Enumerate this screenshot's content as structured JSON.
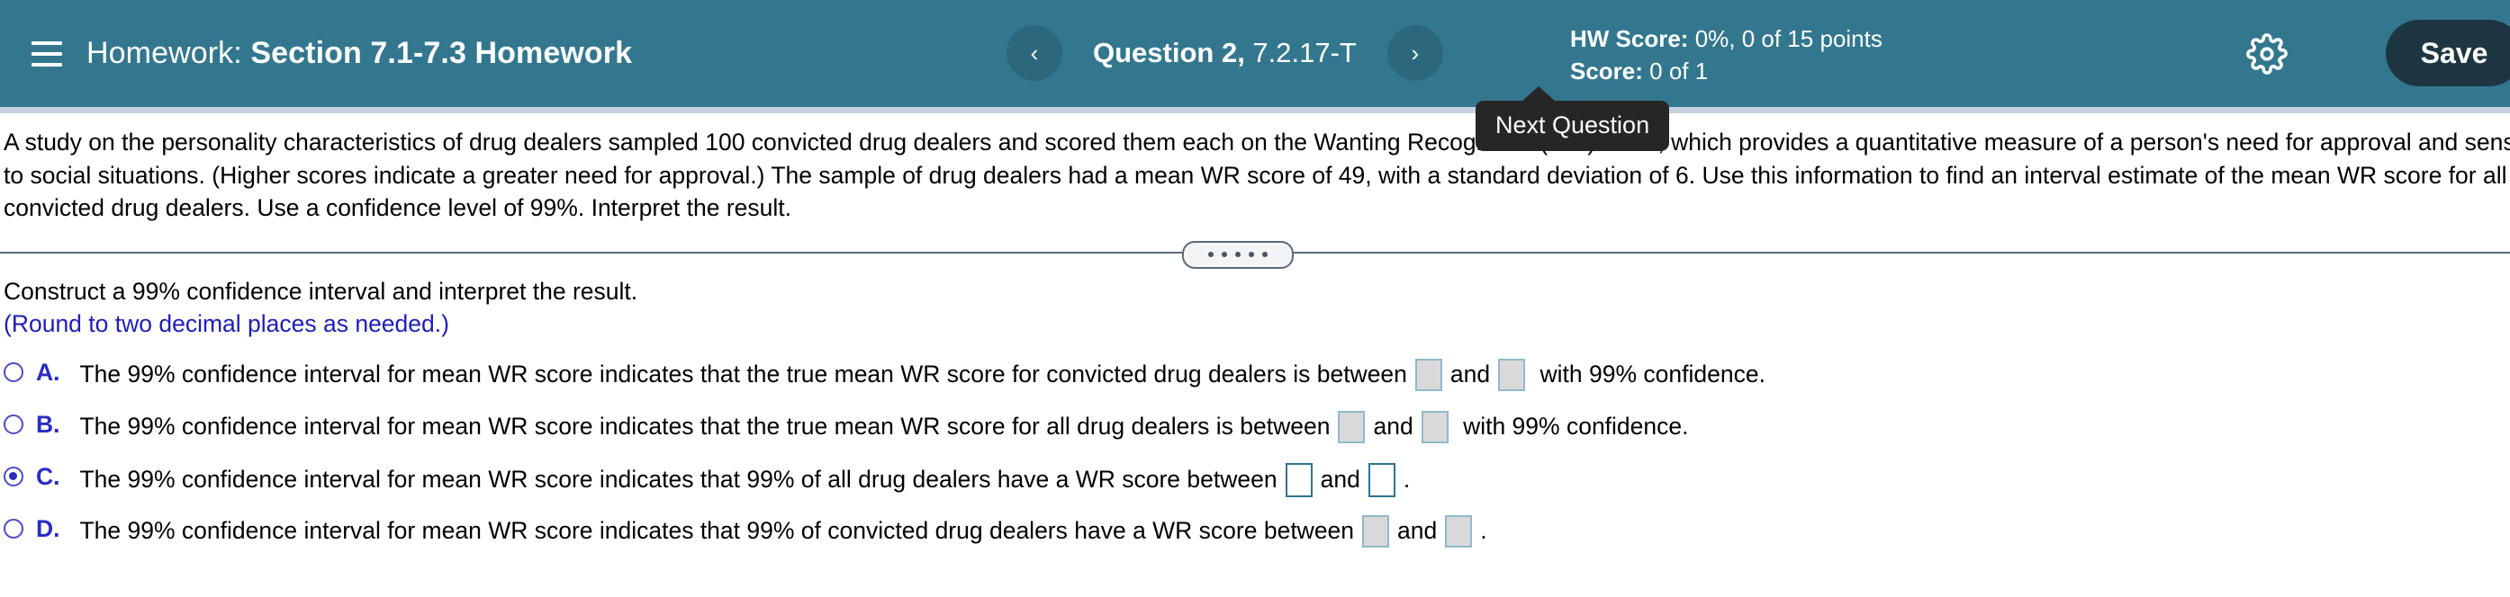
{
  "header": {
    "menu_icon": "hamburger-icon",
    "title_prefix": "Homework: ",
    "title_name": "Section 7.1-7.3 Homework",
    "prev_icon": "‹",
    "next_icon": "›",
    "question_label_strong": "Question 2,",
    "question_label_code": " 7.2.17-T",
    "hw_score_label": "HW Score:",
    "hw_score_value": " 0%, 0 of 15 points",
    "score_label": "Score:",
    "score_value": " 0 of 1",
    "gear_icon": "gear-icon",
    "save_label": "Save",
    "bar_color": "#33778f",
    "save_color": "#1e3542"
  },
  "tooltip": {
    "text": "Next Question"
  },
  "question": {
    "line1": "A study on the personality characteristics of drug dealers sampled 100 convicted drug dealers and scored them each on the Wanting Recognition (WR) scale, which provides a quantitative measure of a person's need for approval and sensitivity",
    "line2": "to social situations. (Higher scores indicate a greater need for approval.) The sample of drug dealers had a mean WR score of 49, with a standard deviation of 6. Use this information to find an interval estimate of the mean WR score for all",
    "line3": "convicted drug dealers. Use a confidence level of 99%. Interpret the result."
  },
  "divider": {
    "dots": 5
  },
  "prompt": {
    "line1": "Construct a 99% confidence interval and interpret the result.",
    "line2": "(Round to two decimal places as needed.)",
    "hint_color": "#1d1dbd"
  },
  "choices": [
    {
      "letter": "A.",
      "selected": false,
      "seg1": "The 99% confidence interval for mean WR score indicates that the true mean WR score for convicted drug dealers is between",
      "seg2": "and",
      "seg3": "with 99% confidence.",
      "box_style": "filled",
      "box1_value": "",
      "box2_value": ""
    },
    {
      "letter": "B.",
      "selected": false,
      "seg1": "The 99% confidence interval for mean WR score indicates that the true mean WR score for all drug dealers is between",
      "seg2": "and",
      "seg3": "with 99% confidence.",
      "box_style": "filled",
      "box1_value": "",
      "box2_value": ""
    },
    {
      "letter": "C.",
      "selected": true,
      "seg1": "The 99% confidence interval for mean WR score indicates that 99% of all drug dealers have a WR score between",
      "seg2": "and",
      "seg3": ".",
      "box_style": "active",
      "box1_value": "",
      "box2_value": ""
    },
    {
      "letter": "D.",
      "selected": false,
      "seg1": "The 99% confidence interval for mean WR score indicates that 99% of convicted drug dealers have a WR score between",
      "seg2": "and",
      "seg3": ".",
      "box_style": "filled",
      "box1_value": "",
      "box2_value": ""
    }
  ]
}
